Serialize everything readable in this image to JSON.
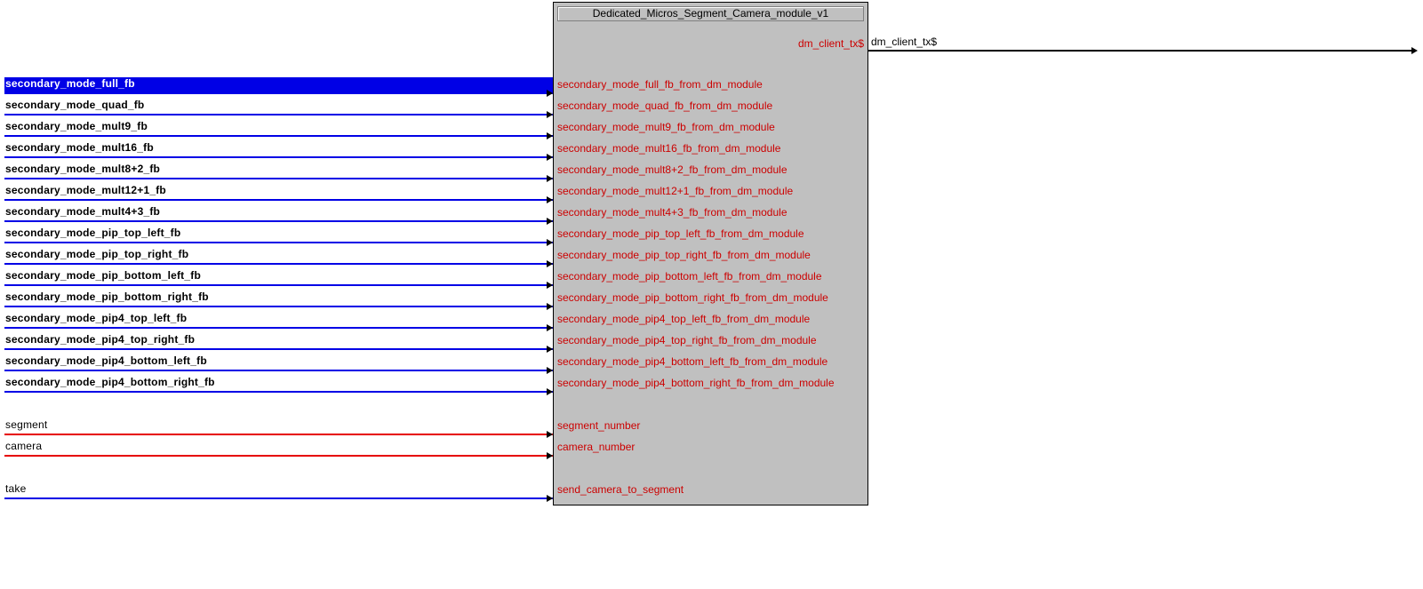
{
  "module": {
    "title": "Dedicated_Micros_Segment_Camera_module_v1",
    "outputs": [
      {
        "port": "dm_client_tx$",
        "signal": "dm_client_tx$"
      }
    ],
    "inputs": [
      {
        "signal": "secondary_mode_full_fb",
        "port": "secondary_mode_full_fb_from_dm_module",
        "kind": "digital",
        "bold": true,
        "selected": true
      },
      {
        "signal": "secondary_mode_quad_fb",
        "port": "secondary_mode_quad_fb_from_dm_module",
        "kind": "digital",
        "bold": true,
        "selected": false
      },
      {
        "signal": "secondary_mode_mult9_fb",
        "port": "secondary_mode_mult9_fb_from_dm_module",
        "kind": "digital",
        "bold": true,
        "selected": false
      },
      {
        "signal": "secondary_mode_mult16_fb",
        "port": "secondary_mode_mult16_fb_from_dm_module",
        "kind": "digital",
        "bold": true,
        "selected": false
      },
      {
        "signal": "secondary_mode_mult8+2_fb",
        "port": "secondary_mode_mult8+2_fb_from_dm_module",
        "kind": "digital",
        "bold": true,
        "selected": false
      },
      {
        "signal": "secondary_mode_mult12+1_fb",
        "port": "secondary_mode_mult12+1_fb_from_dm_module",
        "kind": "digital",
        "bold": true,
        "selected": false
      },
      {
        "signal": "secondary_mode_mult4+3_fb",
        "port": "secondary_mode_mult4+3_fb_from_dm_module",
        "kind": "digital",
        "bold": true,
        "selected": false
      },
      {
        "signal": "secondary_mode_pip_top_left_fb",
        "port": "secondary_mode_pip_top_left_fb_from_dm_module",
        "kind": "digital",
        "bold": true,
        "selected": false
      },
      {
        "signal": "secondary_mode_pip_top_right_fb",
        "port": "secondary_mode_pip_top_right_fb_from_dm_module",
        "kind": "digital",
        "bold": true,
        "selected": false
      },
      {
        "signal": "secondary_mode_pip_bottom_left_fb",
        "port": "secondary_mode_pip_bottom_left_fb_from_dm_module",
        "kind": "digital",
        "bold": true,
        "selected": false
      },
      {
        "signal": "secondary_mode_pip_bottom_right_fb",
        "port": "secondary_mode_pip_bottom_right_fb_from_dm_module",
        "kind": "digital",
        "bold": true,
        "selected": false
      },
      {
        "signal": "secondary_mode_pip4_top_left_fb",
        "port": "secondary_mode_pip4_top_left_fb_from_dm_module",
        "kind": "digital",
        "bold": true,
        "selected": false
      },
      {
        "signal": "secondary_mode_pip4_top_right_fb",
        "port": "secondary_mode_pip4_top_right_fb_from_dm_module",
        "kind": "digital",
        "bold": true,
        "selected": false
      },
      {
        "signal": "secondary_mode_pip4_bottom_left_fb",
        "port": "secondary_mode_pip4_bottom_left_fb_from_dm_module",
        "kind": "digital",
        "bold": true,
        "selected": false
      },
      {
        "signal": "secondary_mode_pip4_bottom_right_fb",
        "port": "secondary_mode_pip4_bottom_right_fb_from_dm_module",
        "kind": "digital",
        "bold": true,
        "selected": false
      },
      {
        "signal": "segment",
        "port": "segment_number",
        "kind": "analog",
        "bold": false,
        "selected": false
      },
      {
        "signal": "camera",
        "port": "camera_number",
        "kind": "analog",
        "bold": false,
        "selected": false
      },
      {
        "signal": "take",
        "port": "send_camera_to_segment",
        "kind": "digital",
        "bold": false,
        "selected": false
      }
    ]
  },
  "colors": {
    "digital": "#0000e6",
    "analog": "#e60000",
    "selected_bg": "#0000e6",
    "port_text": "#cc0000",
    "module_bg": "#c0c0c0"
  }
}
